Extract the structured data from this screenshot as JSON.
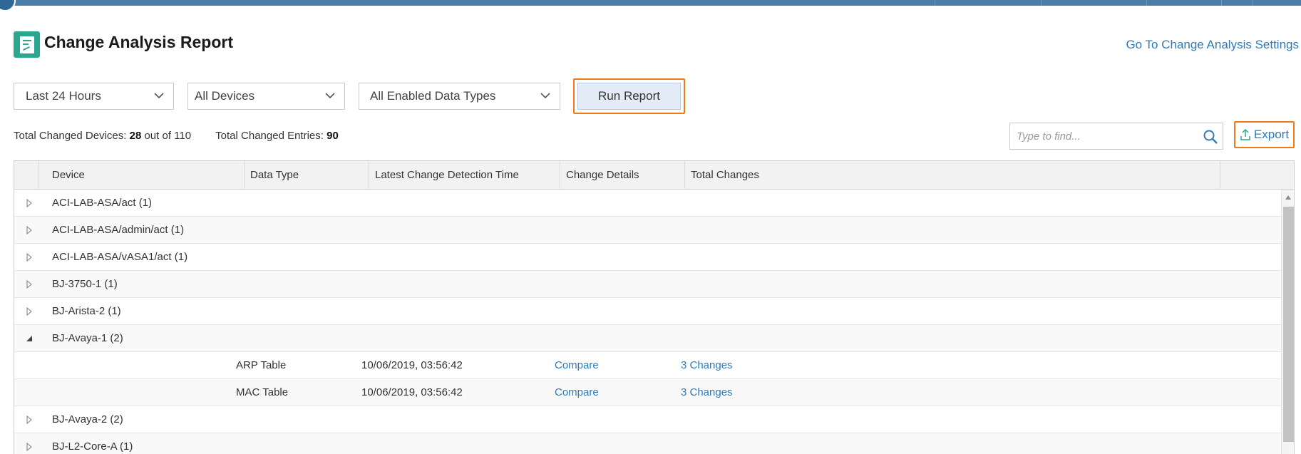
{
  "header": {
    "title": "Change Analysis Report",
    "settings_link": "Go To Change Analysis Settings"
  },
  "filters": {
    "time_range": "Last 24 Hours",
    "devices": "All Devices",
    "data_types": "All Enabled Data Types",
    "run_button": "Run Report"
  },
  "stats": {
    "devices_label": "Total Changed Devices:",
    "devices_changed": "28",
    "devices_of": "out of 110",
    "entries_label": "Total Changed Entries:",
    "entries_changed": "90"
  },
  "search": {
    "placeholder": "Type to find..."
  },
  "export_label": "Export",
  "table": {
    "columns": [
      "Device",
      "Data Type",
      "Latest Change Detection Time",
      "Change Details",
      "Total Changes"
    ],
    "rows": [
      {
        "device": "ACI-LAB-ASA/act (1)",
        "expanded": false
      },
      {
        "device": "ACI-LAB-ASA/admin/act (1)",
        "expanded": false
      },
      {
        "device": "ACI-LAB-ASA/vASA1/act (1)",
        "expanded": false
      },
      {
        "device": "BJ-3750-1 (1)",
        "expanded": false
      },
      {
        "device": "BJ-Arista-2 (1)",
        "expanded": false
      },
      {
        "device": "BJ-Avaya-1 (2)",
        "expanded": true
      },
      {
        "data_type": "ARP Table",
        "time": "10/06/2019, 03:56:42",
        "details": "Compare",
        "total": "3 Changes"
      },
      {
        "data_type": "MAC Table",
        "time": "10/06/2019, 03:56:42",
        "details": "Compare",
        "total": "3 Changes"
      },
      {
        "device": "BJ-Avaya-2 (2)",
        "expanded": false
      },
      {
        "device": "BJ-L2-Core-A (1)",
        "expanded": false
      }
    ]
  },
  "colors": {
    "accent_link": "#2f7ab8",
    "highlight_border": "#f07a1a",
    "topbar": "#4a7da8",
    "report_icon": "#2aa88f"
  }
}
